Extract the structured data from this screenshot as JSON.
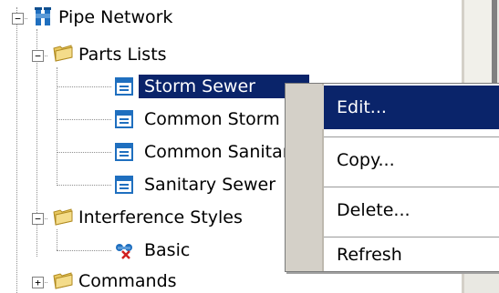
{
  "tree": {
    "root": {
      "label": "Pipe Network",
      "expander": "−"
    },
    "parts_lists": {
      "label": "Parts Lists",
      "expander": "−"
    },
    "items": [
      {
        "label": "Storm Sewer"
      },
      {
        "label": "Common Storm S"
      },
      {
        "label": "Common Sanitar"
      },
      {
        "label": "Sanitary Sewer"
      }
    ],
    "interference": {
      "label": "Interference Styles",
      "expander": "−"
    },
    "basic": {
      "label": "Basic"
    },
    "commands": {
      "label": "Commands",
      "expander": "+"
    }
  },
  "context_menu": {
    "items": [
      {
        "label": "Edit..."
      },
      {
        "label": "Copy..."
      },
      {
        "label": "Delete..."
      },
      {
        "label": "Refresh"
      }
    ]
  },
  "colors": {
    "selection": "#0a246a",
    "menu_gutter": "#d4d0c8",
    "folder": "#e8c860",
    "parts_icon": "#1f6fbf"
  }
}
